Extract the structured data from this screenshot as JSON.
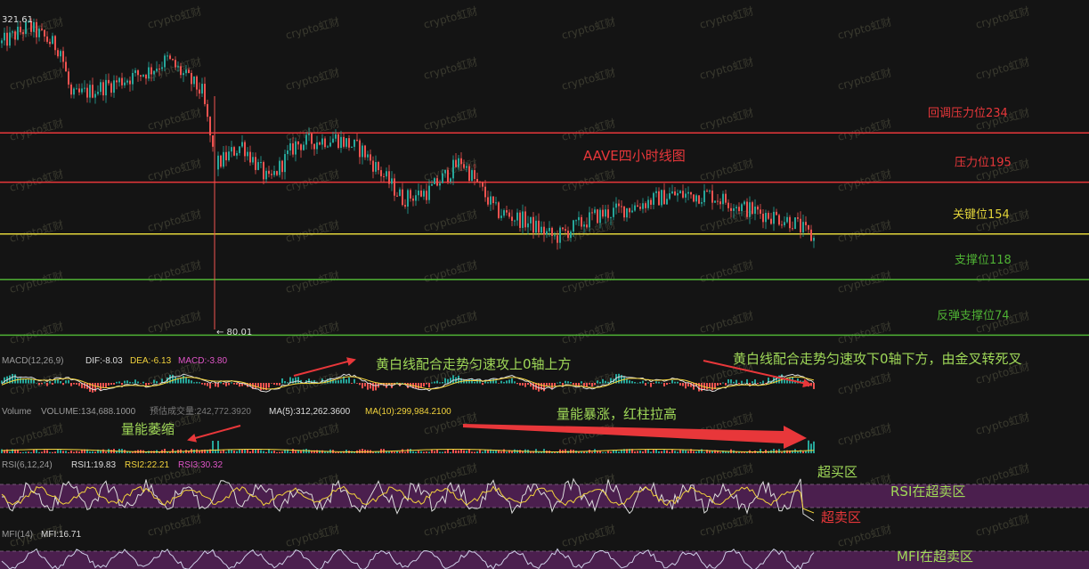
{
  "chart_data": {
    "type": "candlestick",
    "title": "AAVE四小时线图",
    "price_top_label": "321.61",
    "price_low_label": "← 80.01",
    "watermark": "crypto虹财",
    "price_range": [
      70,
      330
    ],
    "candles": [],
    "levels": [
      {
        "label": "回调压力位234",
        "value": 234,
        "color": "#e8373a"
      },
      {
        "label": "压力位195",
        "value": 195,
        "color": "#e8373a"
      },
      {
        "label": "关键位154",
        "value": 154,
        "color": "#e2d43a"
      },
      {
        "label": "支撑位118",
        "value": 118,
        "color": "#4fb234"
      },
      {
        "label": "反弹支撑位74",
        "value": 74,
        "color": "#4fb234"
      }
    ],
    "trend_anchors": [
      {
        "i": 0,
        "p": 305
      },
      {
        "i": 10,
        "p": 318
      },
      {
        "i": 22,
        "p": 300
      },
      {
        "i": 26,
        "p": 262
      },
      {
        "i": 40,
        "p": 272
      },
      {
        "i": 55,
        "p": 283
      },
      {
        "i": 62,
        "p": 292
      },
      {
        "i": 75,
        "p": 266
      },
      {
        "i": 80,
        "p": 208
      },
      {
        "i": 90,
        "p": 225
      },
      {
        "i": 100,
        "p": 195
      },
      {
        "i": 110,
        "p": 225
      },
      {
        "i": 125,
        "p": 230
      },
      {
        "i": 135,
        "p": 220
      },
      {
        "i": 150,
        "p": 182
      },
      {
        "i": 160,
        "p": 188
      },
      {
        "i": 172,
        "p": 212
      },
      {
        "i": 185,
        "p": 172
      },
      {
        "i": 195,
        "p": 165
      },
      {
        "i": 207,
        "p": 151
      },
      {
        "i": 222,
        "p": 168
      },
      {
        "i": 235,
        "p": 175
      },
      {
        "i": 250,
        "p": 185
      },
      {
        "i": 265,
        "p": 185
      },
      {
        "i": 280,
        "p": 173
      },
      {
        "i": 296,
        "p": 164
      },
      {
        "i": 304,
        "p": 150
      }
    ],
    "crash_index": 80,
    "macd": {
      "header": "MACD(12,26,9)",
      "dif": "DIF:-8.03",
      "dea": "DEA:-6.13",
      "macd": "MACD:-3.80"
    },
    "volume": {
      "header": "Volume",
      "volume": "VOLUME:134,688.1000",
      "estimate": "预估成交量:242,772.3920",
      "ma5": "MA(5):312,262.3600",
      "ma10": "MA(10):299,984.2100"
    },
    "rsi": {
      "header": "RSI(6,12,24)",
      "rsi1": "RSI1:19.83",
      "rsi2": "RSI2:22.21",
      "rsi3": "RSI3:30.32"
    },
    "mfi": {
      "header": "MFI(14)",
      "mfi": "MFI:16.71"
    },
    "annotations": {
      "macd_up": "黄白线配合走势匀速攻上0轴上方",
      "macd_down": "黄白线配合走势匀速攻下0轴下方，由金叉转死叉",
      "vol_shrink": "量能萎缩",
      "vol_surge": "量能暴涨，红柱拉高",
      "overbought": "超买区",
      "rsi_oversold": "RSI在超卖区",
      "oversold": "超卖区",
      "mfi_oversold": "MFI在超卖区"
    },
    "colors": {
      "up": "#26a69a",
      "down": "#ef5350",
      "bg": "#141414",
      "yellow": "#f2d33c",
      "white": "#dcdcdc",
      "purple": "#4b1f4e",
      "red_arrow": "#e8373a"
    }
  }
}
